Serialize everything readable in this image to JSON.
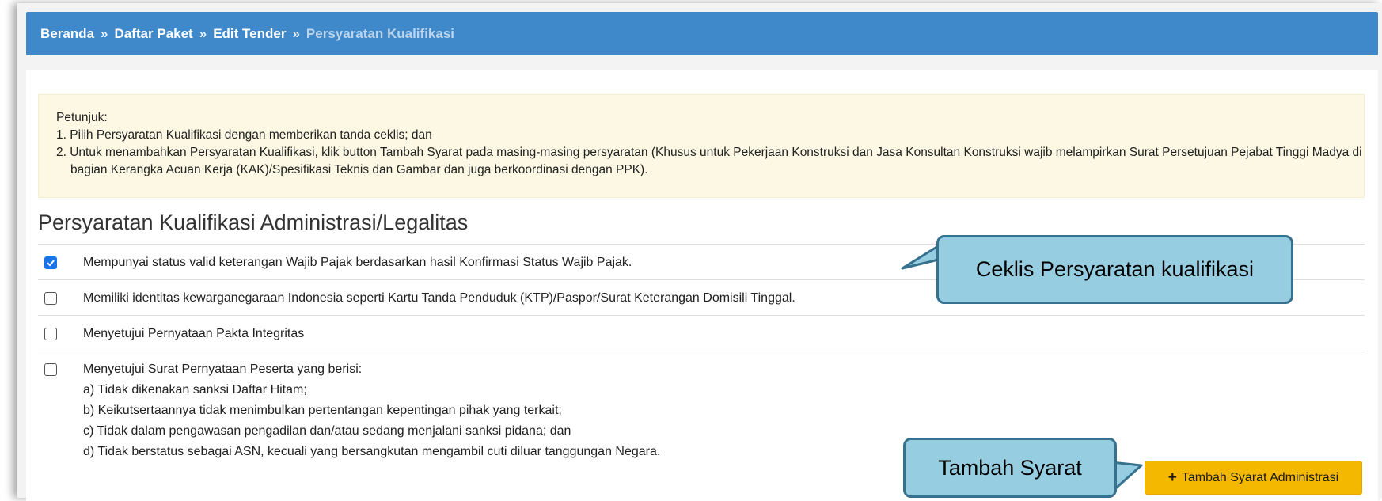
{
  "breadcrumb": {
    "items": [
      "Beranda",
      "Daftar Paket",
      "Edit Tender"
    ],
    "separator": "»",
    "current": "Persyaratan Kualifikasi"
  },
  "notice": {
    "title": "Petunjuk:",
    "line1": "1. Pilih Persyaratan Kualifikasi dengan memberikan tanda ceklis; dan",
    "line2": "2. Untuk menambahkan Persyaratan Kualifikasi, klik button Tambah Syarat pada masing-masing persyaratan (Khusus untuk Pekerjaan Konstruksi dan Jasa Konsultan Konstruksi wajib melampirkan Surat Persetujuan Pejabat Tinggi Madya di bagian Kerangka Acuan Kerja (KAK)/Spesifikasi Teknis dan Gambar dan juga berkoordinasi dengan PPK)."
  },
  "section": {
    "title": "Persyaratan Kualifikasi Administrasi/Legalitas"
  },
  "requirements": [
    {
      "label": "Mempunyai status valid keterangan Wajib Pajak berdasarkan hasil Konfirmasi Status Wajib Pajak.",
      "checked": true
    },
    {
      "label": "Memiliki identitas kewarganegaraan Indonesia seperti Kartu Tanda Penduduk (KTP)/Paspor/Surat Keterangan Domisili Tinggal.",
      "checked": false
    },
    {
      "label": "Menyetujui Pernyataan Pakta Integritas",
      "checked": false
    },
    {
      "label": "Menyetujui Surat Pernyataan Peserta yang berisi:",
      "checked": false,
      "subitems": [
        "a) Tidak dikenakan sanksi Daftar Hitam;",
        "b) Keikutsertaannya tidak menimbulkan pertentangan kepentingan pihak yang terkait;",
        "c) Tidak dalam pengawasan pengadilan dan/atau sedang menjalani sanksi pidana; dan",
        "d) Tidak berstatus sebagai ASN, kecuali yang bersangkutan mengambil cuti diluar tanggungan Negara."
      ]
    }
  ],
  "callouts": {
    "checklist": "Ceklis Persyaratan kualifikasi",
    "add": "Tambah Syarat"
  },
  "add_button": {
    "icon": "plus-icon",
    "label": "Tambah Syarat Administrasi"
  },
  "colors": {
    "breadcrumb_bg": "#3f88c9",
    "notice_bg": "#fcf8e3",
    "checkbox_checked": "#1a73e8",
    "callout_fill": "#97cde0",
    "callout_border": "#36718d",
    "button_bg": "#f5b800"
  }
}
